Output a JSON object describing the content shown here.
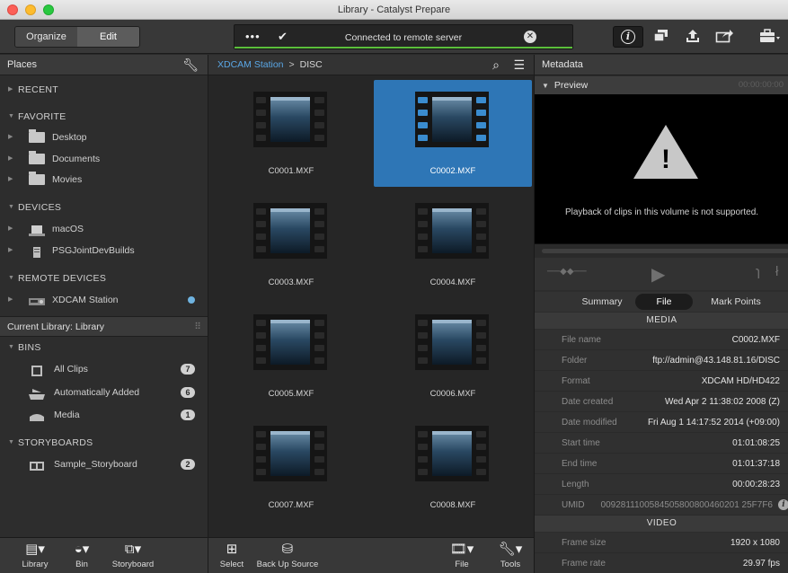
{
  "window": {
    "title": "Library - Catalyst Prepare"
  },
  "toolbar": {
    "organize_label": "Organize",
    "edit_label": "Edit",
    "status_dots": "•••",
    "status_check": "✔",
    "status_message": "Connected to remote server",
    "status_close": "✕"
  },
  "places": {
    "header": "Places",
    "recent": "RECENT",
    "favorite": "FAVORITE",
    "favorites": [
      "Desktop",
      "Documents",
      "Movies"
    ],
    "devices_header": "DEVICES",
    "devices": [
      "macOS",
      "PSGJointDevBuilds"
    ],
    "remote_header": "REMOTE DEVICES",
    "remote": [
      "XDCAM Station"
    ]
  },
  "library": {
    "header": "Current Library: Library",
    "bins_header": "BINS",
    "bins": [
      {
        "label": "All Clips",
        "count": "7"
      },
      {
        "label": "Automatically Added",
        "count": "6"
      },
      {
        "label": "Media",
        "count": "1"
      }
    ],
    "storyboards_header": "STORYBOARDS",
    "storyboards": [
      {
        "label": "Sample_Storyboard",
        "count": "2"
      }
    ]
  },
  "left_bottom": {
    "library": "Library",
    "bin": "Bin",
    "storyboard": "Storyboard"
  },
  "browser": {
    "crumb_root": "XDCAM Station",
    "crumb_sep": ">",
    "crumb_leaf": "DISC",
    "clips": [
      "C0001.MXF",
      "C0002.MXF",
      "C0003.MXF",
      "C0004.MXF",
      "C0005.MXF",
      "C0006.MXF",
      "C0007.MXF",
      "C0008.MXF"
    ],
    "selected_clip": "C0002.MXF",
    "bottom": {
      "select": "Select",
      "backup": "Back Up Source",
      "file": "File",
      "tools": "Tools"
    }
  },
  "metadata": {
    "header": "Metadata",
    "preview_label": "Preview",
    "timecode": "00:00:00:00",
    "playback_message": "Playback of clips in this volume is not supported.",
    "tabs": [
      "Summary",
      "File",
      "Mark Points"
    ],
    "active_tab": "File",
    "media_section": "MEDIA",
    "rows": [
      {
        "key": "File name",
        "value": "C0002.MXF"
      },
      {
        "key": "Folder",
        "value": "ftp://admin@43.148.81.16/DISC"
      },
      {
        "key": "Format",
        "value": "XDCAM HD/HD422"
      },
      {
        "key": "Date created",
        "value": "Wed Apr  2 11:38:02 2008 (Z)"
      },
      {
        "key": "Date modified",
        "value": "Fri Aug  1 14:17:52 2014 (+09:00)"
      },
      {
        "key": "Start time",
        "value": "01:01:08:25"
      },
      {
        "key": "End time",
        "value": "01:01:37:18"
      },
      {
        "key": "Length",
        "value": "00:00:28:23"
      },
      {
        "key": "UMID",
        "value": "0092811100584505800800460201 25F7F6"
      }
    ],
    "video_section": "VIDEO",
    "video_rows": [
      {
        "key": "Frame size",
        "value": "1920 x 1080"
      },
      {
        "key": "Frame rate",
        "value": "29.97 fps"
      }
    ]
  }
}
